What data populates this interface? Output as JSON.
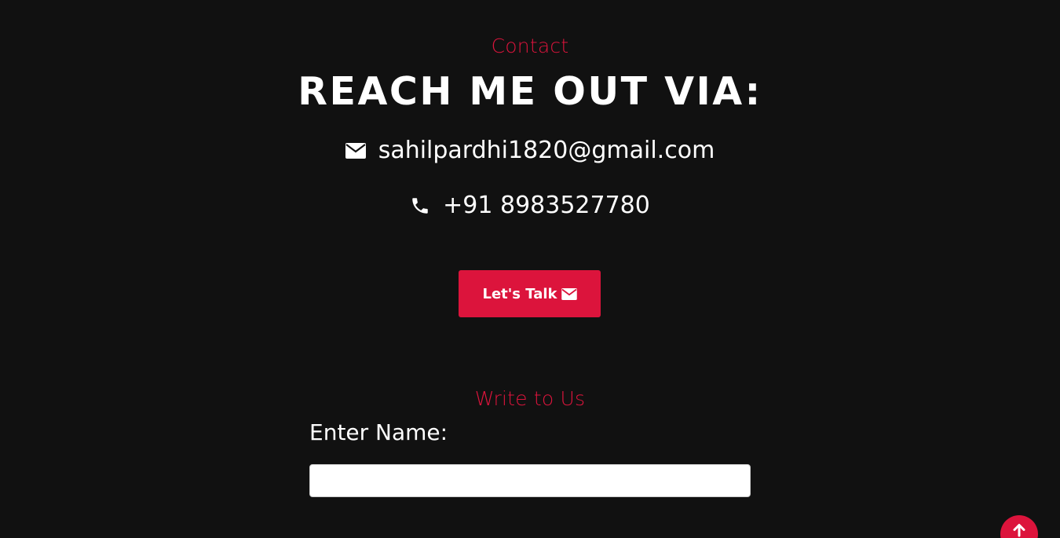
{
  "contact": {
    "kicker": "Contact",
    "heading": "REACH ME OUT VIA:",
    "email": "sahilpardhi1820@gmail.com",
    "email_icon": "envelope-icon",
    "phone": "+91 8983527780",
    "phone_icon": "phone-icon",
    "talk_button_label": "Let's Talk",
    "talk_button_icon": "envelope-icon"
  },
  "form": {
    "kicker": "Write to Us",
    "name_label": "Enter Name:",
    "name_value": ""
  },
  "scroll_top": {
    "icon": "arrow-up-icon"
  },
  "colors": {
    "background": "#111111",
    "accent": "#dc143c",
    "text": "#ffffff"
  }
}
